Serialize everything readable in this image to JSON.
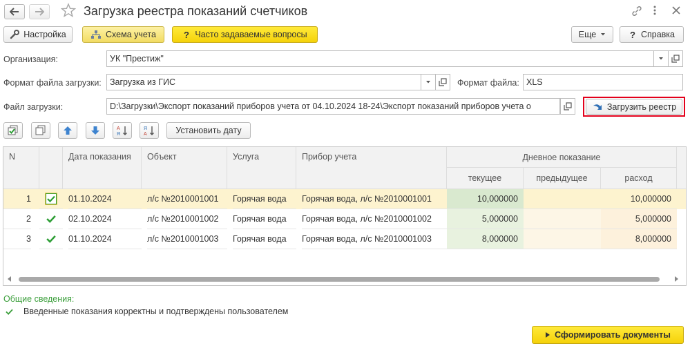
{
  "window": {
    "title": "Загрузка реестра показаний счетчиков"
  },
  "toolbar": {
    "settings_label": "Настройка",
    "scheme_label": "Схема учета",
    "faq_label": "Часто задаваемые вопросы",
    "more_label": "Еще",
    "help_label": "Справка"
  },
  "form": {
    "org_label": "Организация:",
    "org_value": "УК \"Престиж\"",
    "format_label": "Формат файла загрузки:",
    "format_value": "Загрузка из ГИС",
    "filetype_label": "Формат файла:",
    "filetype_value": "XLS",
    "file_label": "Файл загрузки:",
    "file_value": "D:\\Загрузки\\Экспорт показаний приборов учета от 04.10.2024 18-24\\Экспорт показаний приборов учета о",
    "load_label": "Загрузить реестр"
  },
  "table_toolbar": {
    "set_date_label": "Установить дату"
  },
  "table": {
    "columns": {
      "n": "N",
      "date": "Дата показания",
      "object": "Объект",
      "service": "Услуга",
      "device": "Прибор учета",
      "day_group": "Дневное показание",
      "current": "текущее",
      "previous": "предыдущее",
      "consumption": "расход"
    },
    "rows": [
      {
        "n": "1",
        "checked": true,
        "date": "01.10.2024",
        "object": "л/с №2010001001",
        "service": "Горячая вода",
        "device": "Горячая вода, л/с №2010001001",
        "current": "10,000000",
        "previous": "",
        "consumption": "10,000000"
      },
      {
        "n": "2",
        "checked": true,
        "date": "02.10.2024",
        "object": "л/с №2010001002",
        "service": "Горячая вода",
        "device": "Горячая вода, л/с №2010001002",
        "current": "5,000000",
        "previous": "",
        "consumption": "5,000000"
      },
      {
        "n": "3",
        "checked": true,
        "date": "01.10.2024",
        "object": "л/с №2010001003",
        "service": "Горячая вода",
        "device": "Горячая вода, л/с №2010001003",
        "current": "8,000000",
        "previous": "",
        "consumption": "8,000000"
      }
    ]
  },
  "info": {
    "heading": "Общие сведения:",
    "message": "Введенные показания корректны и подтверждены пользователем"
  },
  "footer": {
    "generate_label": "Сформировать документы"
  },
  "colors": {
    "accent_green": "#3a9e3a",
    "selected_row": "#fdf3cf",
    "current_col": "#e8f2df",
    "consumption_col": "#fdf1dc",
    "highlight_border": "#e3001b",
    "primary_button": "#f5d20a"
  }
}
